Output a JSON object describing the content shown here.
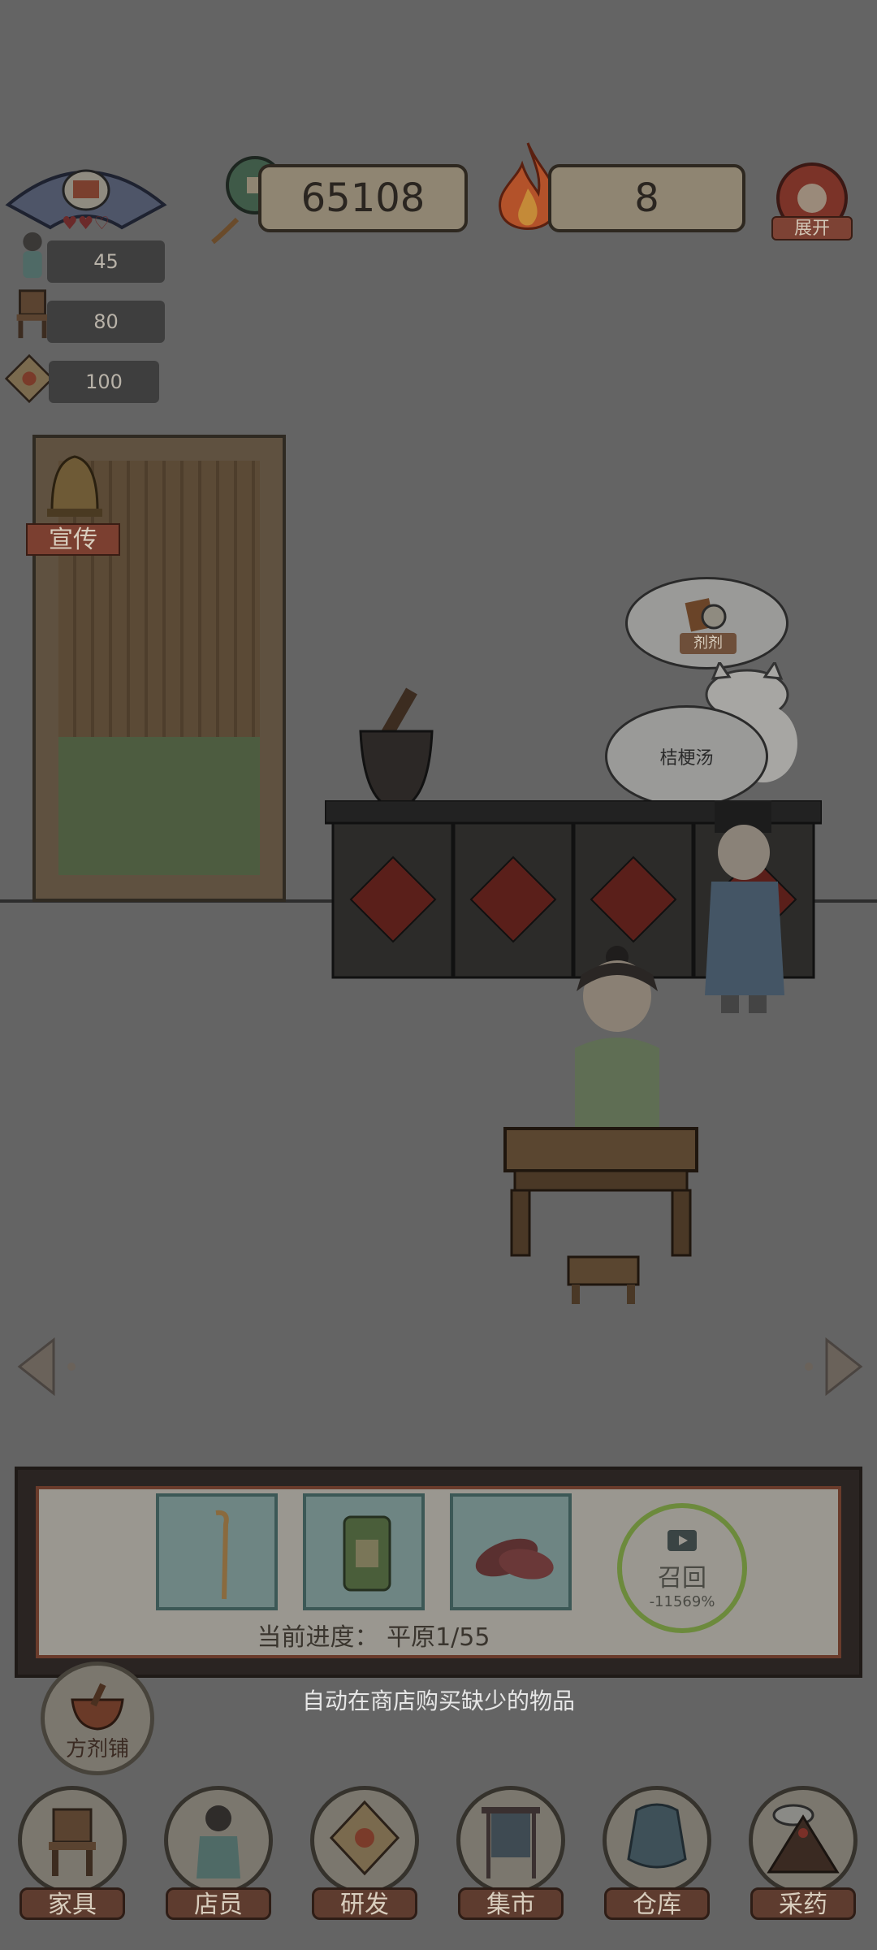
{
  "currency": {
    "coins": "65108",
    "fire": "8"
  },
  "expand_label": "展开",
  "stats": [
    {
      "icon": "staff-girl-icon",
      "value": "45"
    },
    {
      "icon": "chair-icon",
      "value": "80"
    },
    {
      "icon": "herb-package-icon",
      "value": "100"
    }
  ],
  "room": {
    "promo_label": "宣传",
    "bubble_top_label": "剂剂",
    "bubble_order": "桔梗汤"
  },
  "panel": {
    "items": [
      "walking-stick-icon",
      "herb-jar-icon",
      "sweet-potato-icon"
    ],
    "progress": "当前进度： 平原1/55",
    "recall_label": "召回",
    "recall_value": "-11569%"
  },
  "hint": "自动在商店购买缺少的物品",
  "shop_button": "方剂铺",
  "nav": [
    {
      "label": "家具",
      "icon": "furniture-chair-icon"
    },
    {
      "label": "店员",
      "icon": "staff-icon"
    },
    {
      "label": "研发",
      "icon": "research-package-icon"
    },
    {
      "label": "集市",
      "icon": "market-stall-icon"
    },
    {
      "label": "仓库",
      "icon": "warehouse-bag-icon"
    },
    {
      "label": "采药",
      "icon": "mountain-herb-icon"
    }
  ],
  "colors": {
    "background": "#646464",
    "panel_border": "#6a3b2b",
    "nav_label_bg": "#5e3c2f"
  }
}
